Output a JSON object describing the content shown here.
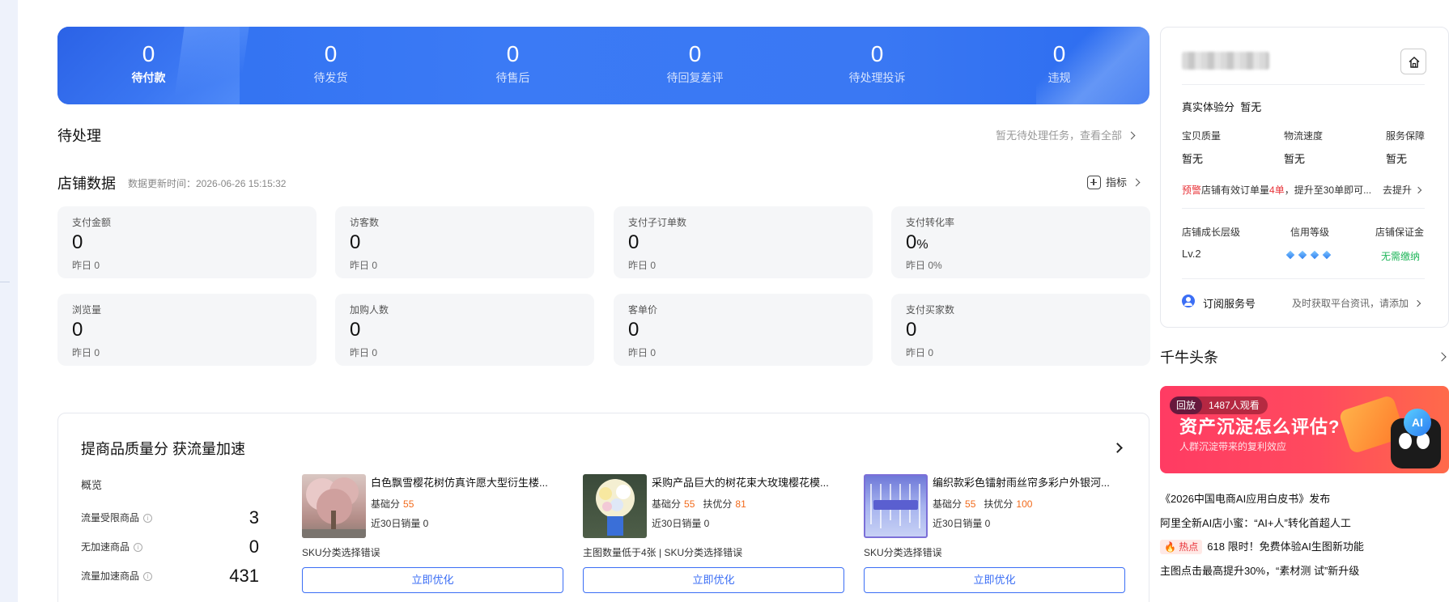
{
  "banner": {
    "stats": [
      {
        "value": "0",
        "label": "待付款"
      },
      {
        "value": "0",
        "label": "待发货"
      },
      {
        "value": "0",
        "label": "待售后"
      },
      {
        "value": "0",
        "label": "待回复差评"
      },
      {
        "value": "0",
        "label": "待处理投诉"
      },
      {
        "value": "0",
        "label": "违规"
      }
    ]
  },
  "todo": {
    "title": "待处理",
    "link": "暂无待处理任务，查看全部"
  },
  "store_data": {
    "title": "店铺数据",
    "updated": "数据更新时间：2026-06-26 15:15:32",
    "metric_link": "指标",
    "cards": [
      {
        "label": "支付金额",
        "value": "0",
        "unit": "",
        "yesterday": "昨日 0"
      },
      {
        "label": "访客数",
        "value": "0",
        "unit": "",
        "yesterday": "昨日 0"
      },
      {
        "label": "支付子订单数",
        "value": "0",
        "unit": "",
        "yesterday": "昨日 0"
      },
      {
        "label": "支付转化率",
        "value": "0",
        "unit": "%",
        "yesterday": "昨日 0%"
      },
      {
        "label": "浏览量",
        "value": "0",
        "unit": "",
        "yesterday": "昨日 0"
      },
      {
        "label": "加购人数",
        "value": "0",
        "unit": "",
        "yesterday": "昨日 0"
      },
      {
        "label": "客单价",
        "value": "0",
        "unit": "",
        "yesterday": "昨日 0"
      },
      {
        "label": "支付买家数",
        "value": "0",
        "unit": "",
        "yesterday": "昨日 0"
      }
    ]
  },
  "quality": {
    "title": "提商品质量分 获流量加速",
    "overview_title": "概览",
    "overview": [
      {
        "label": "流量受限商品",
        "value": "3"
      },
      {
        "label": "无加速商品",
        "value": "0"
      },
      {
        "label": "流量加速商品",
        "value": "431"
      }
    ],
    "products": [
      {
        "name": "白色飘雪樱花树仿真许愿大型衍生楼...",
        "base_label": "基础分",
        "base": "55",
        "support_label": "",
        "support": "",
        "sales": "近30日销量 0",
        "issue": "SKU分类选择错误",
        "button": "立即优化"
      },
      {
        "name": "采购产品巨大的树花束大玫瑰樱花模...",
        "base_label": "基础分",
        "base": "55",
        "support_label": "扶优分",
        "support": "81",
        "sales": "近30日销量 0",
        "issue": "主图数量低于4张 | SKU分类选择错误",
        "button": "立即优化"
      },
      {
        "name": "编织款彩色镭射雨丝帘多彩户外银河...",
        "base_label": "基础分",
        "base": "55",
        "support_label": "扶优分",
        "support": "100",
        "sales": "近30日销量 0",
        "issue": "SKU分类选择错误",
        "button": "立即优化"
      }
    ]
  },
  "shop_panel": {
    "experience_label": "真实体验分",
    "experience_value": "暂无",
    "scores": [
      {
        "label": "宝贝质量",
        "value": "暂无"
      },
      {
        "label": "物流速度",
        "value": "暂无"
      },
      {
        "label": "服务保障",
        "value": "暂无"
      }
    ],
    "warning_tag": "预警",
    "warning_text_1": "店铺有效订单量",
    "warning_count": "4单",
    "warning_text_2": "，提升至30单即可...",
    "warning_action": "去提升",
    "levels": [
      {
        "label": "店铺成长层级",
        "value": "Lv.2"
      },
      {
        "label": "信用等级",
        "value": ""
      },
      {
        "label": "店铺保证金",
        "value": "无需缴纳"
      }
    ],
    "subscribe_label": "订阅服务号",
    "subscribe_hint": "及时获取平台资讯，请添加"
  },
  "headlines": {
    "title": "千牛头条",
    "promo": {
      "tag": "回放",
      "viewers": "1487人观看",
      "title": "资产沉淀怎么评估?",
      "subtitle": "人群沉淀带来的复利效应",
      "badge": "AI"
    },
    "items": [
      {
        "hot": "",
        "text": "《2026中国电商AI应用白皮书》发布"
      },
      {
        "hot": "",
        "text": "阿里全新AI店小蜜：“AI+人”转化首超人工"
      },
      {
        "hot": "🔥 热点",
        "text": "618 限时！免费体验AI生图新功能"
      },
      {
        "hot": "",
        "text": "主图点击最高提升30%，“素材测 试”新升级"
      }
    ]
  },
  "colors": {
    "accent": "#3b6ef5",
    "warning": "#e8343a",
    "score": "#f26a1b",
    "success": "#1fb65a"
  }
}
